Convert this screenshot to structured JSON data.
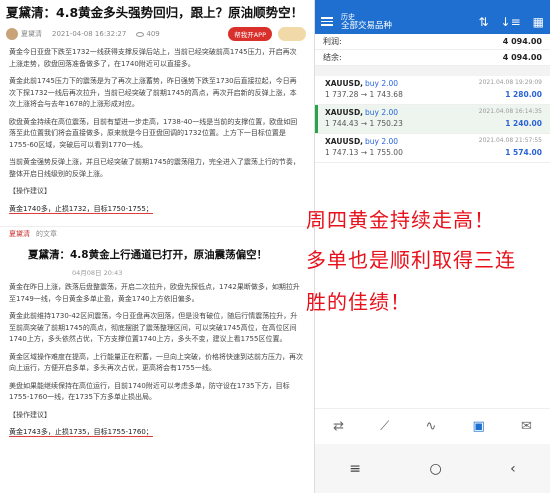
{
  "article1": {
    "title": "夏黛清：4.8黄金多头强势回归，跟上？原油顺势空！",
    "author": "夏黛清",
    "datetime": "2021-04-08 16:32:27",
    "views": "409",
    "app_button": "帮我开APP",
    "paragraphs": [
      "黄金今日亚盘下跌至1732一线获得支撑反弹后站上，当前已经突破前高1745压力，开启再次上涨走势，欧盘回落准备做多了，在1740附近可以直接多。",
      "黄金此前1745压力下的震荡是为了再次上涨蓄势，昨日强势下跌至1730后直接拉起，今日再次下探1732一线后再次拉升，当前已经突破了前期1745的高点，再次开启新的反弹上涨，本次上涨将会与去年1678的上涨形成对应。",
      "欧盘黄金持续在高位震荡，目前有望进一步走高，1738-40一线是当前的支撑位置，欧盘如回落至此位置我们将会直接做多，原来就是今日亚盘回调的1732位置。上方下一目标位置是1755-60区域，突破后可以看到1770一线。",
      "当前黄金强势反弹上涨，并且已经突破了前期1745的震荡阻力，完全进入了震荡上行的节奏，整体开启日线级别的反弹上涨。"
    ],
    "suggest_label": "【操作建议】",
    "suggestion": "黄金1740多，止损1732，目标1750-1755；"
  },
  "article2": {
    "author_tag": "夏黛清",
    "author_tag_suffix": "的文章",
    "title": "夏黛清：4.8黄金上行通道已打开，原油震荡偏空！",
    "meta": "04月08日 20:43",
    "paragraphs": [
      "黄金在昨日上涨，跌落后盘整震荡，开启二次拉升，欧盘先探低点，1742果断做多，如期拉升至1749一线，今日黄金多单止盈，黄金1740上方依旧偏多。",
      "黄金此前维持1730-42区间震荡，今日亚盘再次回落，但是没有破位，随后行情震荡拉升，升至前高突破了前期1745的高点，彻底摆脱了震荡整理区间，可以突破1745高位，在高位区间1740上方，多头依然占优，下方支撑位置1740上方，多头不变，建议上看1755区位置。",
      "黄金区域操作难度在提高，上行能量正在积蓄，一旦向上突破，价格将快速到达前方压力，再次向上运行，方便开启多单，多头再次占优，更高将会有1755一线。",
      "美盘如果能继续保持在高位运行，目前1740附近可以考虑多单，防守设在1735下方，目标1755-1760一线，在1735下方多单止损出局。"
    ],
    "suggest_label": "【操作建议】",
    "suggestion": "黄金1743多，止损1735，目标1755-1760；"
  },
  "app": {
    "title": "历史",
    "subtitle": "全部交易品种",
    "profit_label": "利润:",
    "profit_value": "4 094.00",
    "balance_label": "结余:",
    "balance_value": "4 094.00",
    "trades": [
      {
        "symbol": "XAUUSD,",
        "side": "buy 2.00",
        "prices": "1 737.28 → 1 743.68",
        "date": "2021.04.08 19:29:09",
        "profit": "1 280.00",
        "active": false
      },
      {
        "symbol": "XAUUSD,",
        "side": "buy 2.00",
        "prices": "1 744.43 → 1 750.23",
        "date": "2021.04.08 16:14:35",
        "profit": "1 240.00",
        "active": true
      },
      {
        "symbol": "XAUUSD,",
        "side": "buy 2.00",
        "prices": "1 747.13 → 1 755.00",
        "date": "2021.04.08 21:57:55",
        "profit": "1 574.00",
        "active": false
      }
    ],
    "overlay_lines": [
      "周四黄金持续走高！",
      "多单也是顺利取得三连",
      "胜的佳绩！"
    ],
    "accent": "#1e6fd0",
    "overlay_color": "#e8101a"
  }
}
